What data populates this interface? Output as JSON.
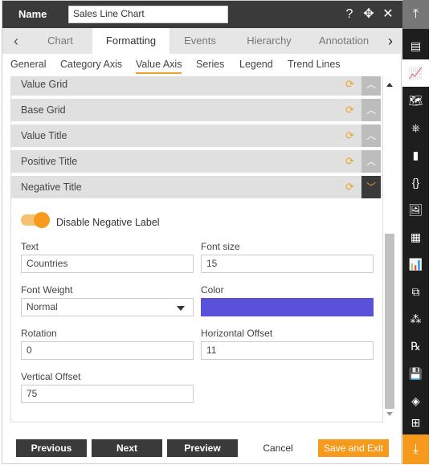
{
  "header": {
    "name_label": "Name",
    "name_value": "Sales Line Chart",
    "help_icon": "?",
    "move_icon": "✥",
    "close_icon": "✕"
  },
  "tabs": {
    "prev": "‹",
    "next": "›",
    "items": [
      {
        "label": "Chart"
      },
      {
        "label": "Formatting"
      },
      {
        "label": "Events"
      },
      {
        "label": "Hierarchy"
      },
      {
        "label": "Annotation"
      }
    ]
  },
  "subtabs": [
    {
      "label": "General"
    },
    {
      "label": "Category Axis"
    },
    {
      "label": "Value Axis"
    },
    {
      "label": "Series"
    },
    {
      "label": "Legend"
    },
    {
      "label": "Trend Lines"
    }
  ],
  "sections": [
    {
      "label": "Value Grid"
    },
    {
      "label": "Base Grid"
    },
    {
      "label": "Value Title"
    },
    {
      "label": "Positive Title"
    },
    {
      "label": "Negative Title"
    }
  ],
  "negative_title": {
    "toggle_label": "Disable Negative Label",
    "toggle_on": true,
    "text_label": "Text",
    "text_value": "Countries",
    "font_size_label": "Font size",
    "font_size_value": "15",
    "font_weight_label": "Font Weight",
    "font_weight_value": "Normal",
    "color_label": "Color",
    "color_value": "#5b50d9",
    "rotation_label": "Rotation",
    "rotation_value": "0",
    "h_offset_label": "Horizontal Offset",
    "h_offset_value": "11",
    "v_offset_label": "Vertical Offset",
    "v_offset_value": "75"
  },
  "footer": {
    "previous": "Previous",
    "next": "Next",
    "preview": "Preview",
    "cancel": "Cancel",
    "save_exit": "Save and Exit"
  },
  "sidebar": {
    "top_icon": "⤒",
    "bottom_icon": "⤓",
    "items": [
      {
        "icon": "▤"
      },
      {
        "icon": "📈"
      },
      {
        "icon": "🗺"
      },
      {
        "icon": "⎈"
      },
      {
        "icon": "▮"
      },
      {
        "icon": "{}"
      },
      {
        "icon": "🖼"
      },
      {
        "icon": "▦"
      },
      {
        "icon": "📊"
      },
      {
        "icon": "⧉"
      },
      {
        "icon": "⁂"
      },
      {
        "icon": "℞"
      },
      {
        "icon": "💾"
      },
      {
        "icon": "◈"
      },
      {
        "icon": "⊞"
      }
    ]
  },
  "colors": {
    "accent": "#f59a1c",
    "dark": "#3a3a3a",
    "color_swatch": "#5b50d9"
  }
}
